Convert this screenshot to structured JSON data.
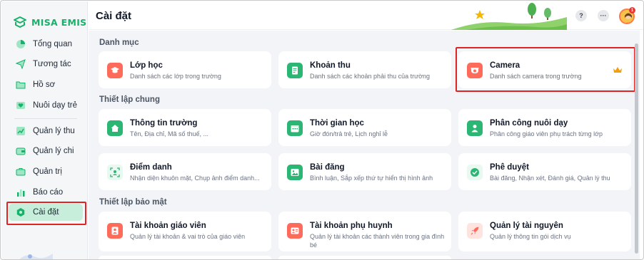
{
  "app": {
    "logo_text": "MISA EMIS"
  },
  "sidebar": {
    "items": [
      {
        "label": "Tổng quan",
        "icon": "pie-chart-icon"
      },
      {
        "label": "Tương tác",
        "icon": "paper-plane-icon"
      },
      {
        "label": "Hồ sơ",
        "icon": "folder-icon"
      },
      {
        "label": "Nuôi dạy trẻ",
        "icon": "heart-icon"
      },
      {
        "label": "Quản lý thu",
        "icon": "trend-chart-icon"
      },
      {
        "label": "Quản lý chi",
        "icon": "wallet-icon"
      },
      {
        "label": "Quản trị",
        "icon": "briefcase-icon"
      },
      {
        "label": "Báo cáo",
        "icon": "bar-chart-icon"
      },
      {
        "label": "Cài đặt",
        "icon": "settings-icon",
        "active": true
      }
    ]
  },
  "header": {
    "title": "Cài đặt",
    "help_label": "?",
    "more_label": "···",
    "notification_count": "1"
  },
  "sections": [
    {
      "title": "Danh mục",
      "cards": [
        {
          "title": "Lớp học",
          "desc": "Danh sách các lớp trong trường",
          "icon": "graduation-cap-icon",
          "color": "#ff6b5b"
        },
        {
          "title": "Khoản thu",
          "desc": "Danh sách các khoản phải thu của trường",
          "icon": "receipt-icon",
          "color": "#2bb673"
        },
        {
          "title": "Camera",
          "desc": "Danh sách camera trong trường",
          "icon": "camera-icon",
          "color": "#ff6b5b",
          "premium": true
        }
      ]
    },
    {
      "title": "Thiết lập chung",
      "cards": [
        {
          "title": "Thông tin trường",
          "desc": "Tên, Địa chỉ, Mã số thuế, ...",
          "icon": "home-icon",
          "color": "#2bb673"
        },
        {
          "title": "Thời gian học",
          "desc": "Giờ đón/trả trẻ, Lịch nghỉ lễ",
          "icon": "calendar-icon",
          "color": "#2bb673"
        },
        {
          "title": "Phân công nuôi dạy",
          "desc": "Phân công giáo viên phụ trách từng lớp",
          "icon": "person-icon",
          "color": "#2bb673"
        },
        {
          "title": "Điểm danh",
          "desc": "Nhận diện khuôn mặt, Chụp ảnh điểm danh...",
          "icon": "face-scan-icon",
          "color": "#2bb673"
        },
        {
          "title": "Bài đăng",
          "desc": "Bình luận, Sắp xếp thứ tự hiển thị hình ảnh",
          "icon": "image-icon",
          "color": "#2bb673"
        },
        {
          "title": "Phê duyệt",
          "desc": "Bài đăng, Nhận xét, Đánh giá, Quản lý thu",
          "icon": "check-circle-icon",
          "color": "#2bb673"
        }
      ]
    },
    {
      "title": "Thiết lập bảo mật",
      "cards": [
        {
          "title": "Tài khoản giáo viên",
          "desc": "Quản lý tài khoản & vai trò của giáo viên",
          "icon": "teacher-account-icon",
          "color": "#ff6b5b"
        },
        {
          "title": "Tài khoản phụ huynh",
          "desc": "Quản lý tài khoản các thành viên trong gia đình bé",
          "icon": "parent-account-icon",
          "color": "#ff6b5b"
        },
        {
          "title": "Quản lý tài nguyên",
          "desc": "Quản lý thông tin gói dịch vụ",
          "icon": "rocket-icon",
          "color": "#ff6b5b"
        }
      ]
    }
  ],
  "colors": {
    "brand": "#17b26a",
    "active_nav_bg": "#c7eedb",
    "highlight": "#e02424",
    "premium": "#f59e0b"
  }
}
